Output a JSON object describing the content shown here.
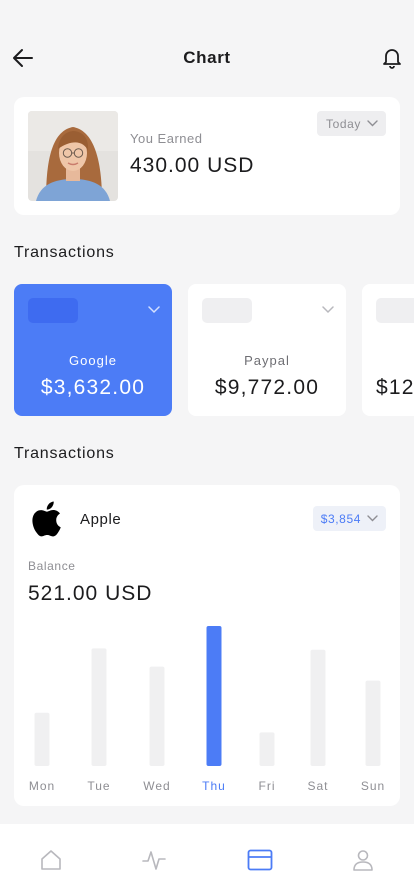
{
  "header": {
    "title": "Chart"
  },
  "earnings": {
    "label": "You Earned",
    "value": "430.00 USD",
    "period": "Today"
  },
  "sections": {
    "transactions_1": "Transactions",
    "transactions_2": "Transactions"
  },
  "transactions": [
    {
      "name": "Google",
      "amount": "$3,632.00",
      "active": true
    },
    {
      "name": "Paypal",
      "amount": "$9,772.00",
      "active": false
    },
    {
      "name": "",
      "amount": "$12",
      "active": false
    }
  ],
  "balance_card": {
    "company": "Apple",
    "selected_amount": "$3,854",
    "balance_label": "Balance",
    "balance_value": "521.00 USD"
  },
  "chart_data": {
    "type": "bar",
    "categories": [
      "Mon",
      "Tue",
      "Wed",
      "Thu",
      "Fri",
      "Sat",
      "Sun"
    ],
    "values": [
      38,
      84,
      71,
      100,
      24,
      83,
      61
    ],
    "highlight": "Thu",
    "colors": {
      "bar": "#f0f0f1",
      "highlight": "#4c7cf6",
      "label": "#8e8e93"
    }
  },
  "tabbar": {
    "items": [
      {
        "icon": "home-icon",
        "active": false
      },
      {
        "icon": "activity-icon",
        "active": false
      },
      {
        "icon": "card-icon",
        "active": true
      },
      {
        "icon": "profile-icon",
        "active": false
      }
    ]
  },
  "colors": {
    "accent": "#4c7cf6",
    "background": "#f5f5f6",
    "card": "#ffffff"
  }
}
